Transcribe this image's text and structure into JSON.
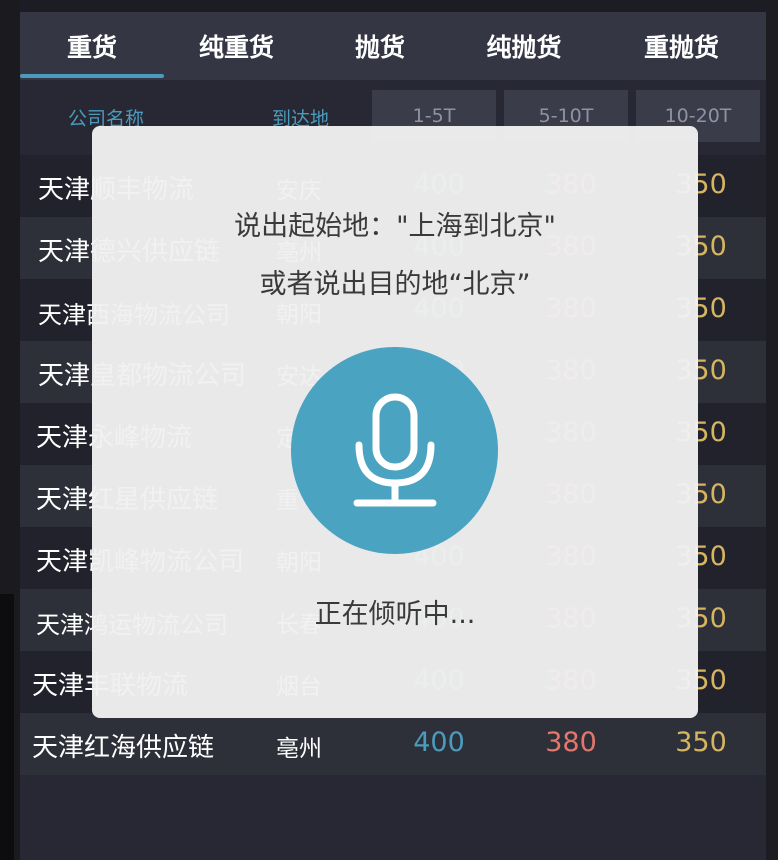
{
  "tabs": [
    {
      "label": "重货",
      "active": true
    },
    {
      "label": "纯重货",
      "active": false
    },
    {
      "label": "抛货",
      "active": false
    },
    {
      "label": "纯抛货",
      "active": false
    },
    {
      "label": "重抛货",
      "active": false
    }
  ],
  "table": {
    "headers": {
      "company": "公司名称",
      "destination": "到达地",
      "w1": "1-5T",
      "w2": "5-10T",
      "w3": "10-20T"
    },
    "rows": [
      {
        "company": "天津顺丰物流",
        "destination": "安庆",
        "p1": "400",
        "p2": "380",
        "p3": "350"
      },
      {
        "company": "天津德兴供应链",
        "destination": "亳州",
        "p1": "400",
        "p2": "380",
        "p3": "350"
      },
      {
        "company": "天津西海物流公司",
        "destination": "朝阳",
        "p1": "400",
        "p2": "380",
        "p3": "350"
      },
      {
        "company": "天津皇都物流公司",
        "destination": "安达",
        "p1": "400",
        "p2": "380",
        "p3": "350"
      },
      {
        "company": "天津永峰物流",
        "destination": "定",
        "p1": "400",
        "p2": "380",
        "p3": "350"
      },
      {
        "company": "天津红星供应链",
        "destination": "重",
        "p1": "400",
        "p2": "380",
        "p3": "350"
      },
      {
        "company": "天津凯峰物流公司",
        "destination": "朝阳",
        "p1": "400",
        "p2": "380",
        "p3": "350"
      },
      {
        "company": "天津鸿运物流公司",
        "destination": "长春",
        "p1": "400",
        "p2": "380",
        "p3": "350"
      },
      {
        "company": "天津丰联物流",
        "destination": "烟台",
        "p1": "400",
        "p2": "380",
        "p3": "350"
      },
      {
        "company": "天津红海供应链",
        "destination": "亳州",
        "p1": "400",
        "p2": "380",
        "p3": "350"
      }
    ]
  },
  "voice_dialog": {
    "prompt_line1": "说出起始地：\"上海到北京\"",
    "prompt_line2": "或者说出目的地“北京”",
    "mic_icon": "microphone-icon",
    "status": "正在倾听中..."
  },
  "colors": {
    "accent": "#4a9bbd",
    "price_low": "#4a9bbd",
    "price_mid": "#e4776c",
    "price_high": "#d6b561",
    "tab_bar": "#343644",
    "mic_button": "#4aa3c1"
  }
}
